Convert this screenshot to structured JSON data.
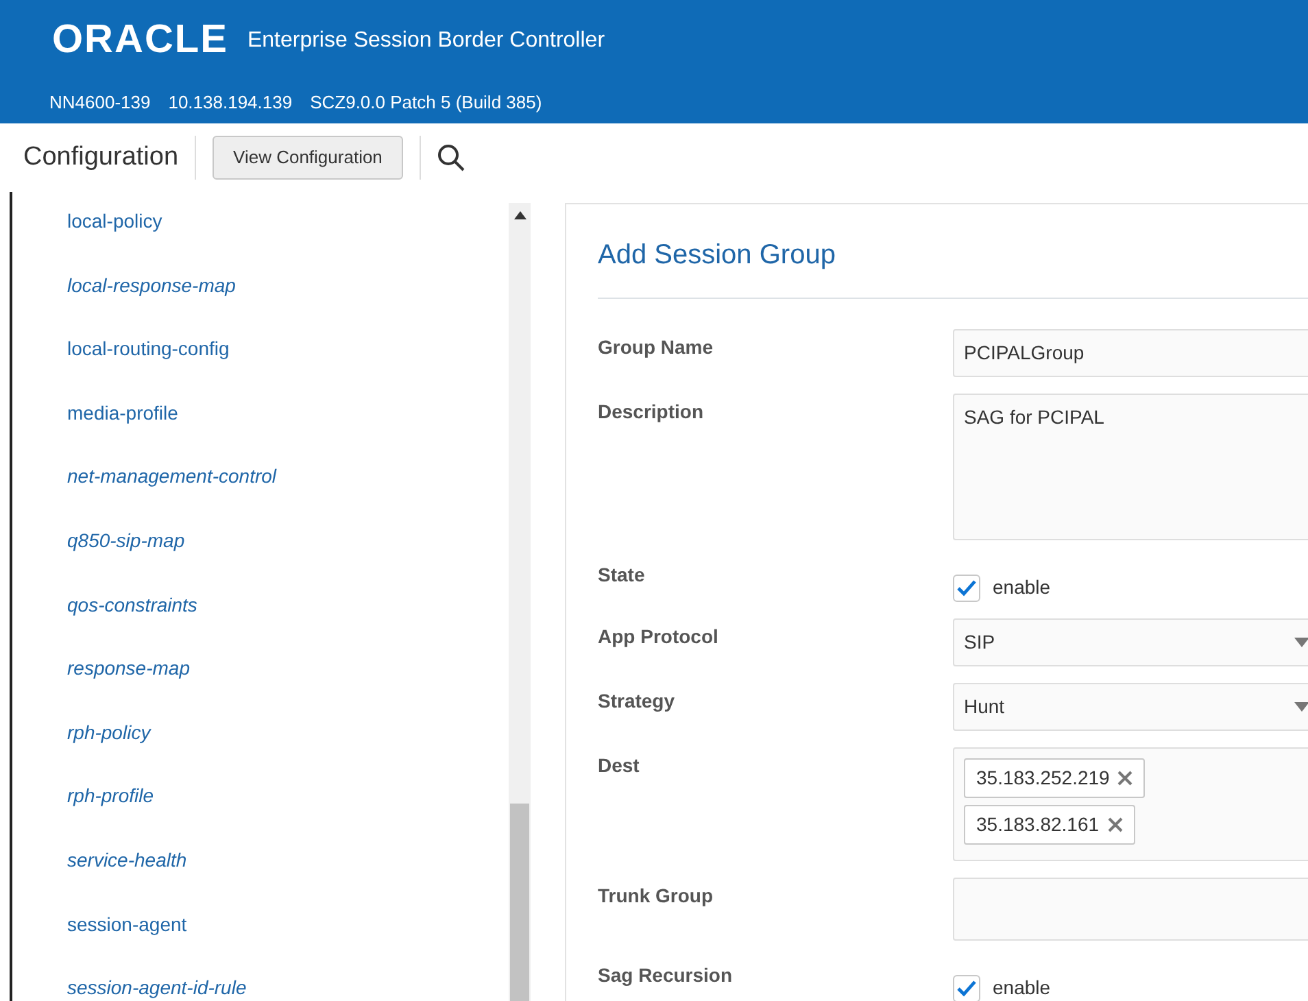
{
  "header": {
    "logo": "ORACLE",
    "product": "Enterprise Session Border Controller",
    "info": [
      "NN4600-139",
      "10.138.194.139",
      "SCZ9.0.0 Patch 5 (Build 385)"
    ]
  },
  "toolbar": {
    "title": "Configuration",
    "button": "View Configuration"
  },
  "sidebar": {
    "items": [
      {
        "label": "local-policy",
        "emphasized": false
      },
      {
        "label": "local-response-map",
        "emphasized": true
      },
      {
        "label": "local-routing-config",
        "emphasized": false
      },
      {
        "label": "media-profile",
        "emphasized": false
      },
      {
        "label": "net-management-control",
        "emphasized": true
      },
      {
        "label": "q850-sip-map",
        "emphasized": true
      },
      {
        "label": "qos-constraints",
        "emphasized": true
      },
      {
        "label": "response-map",
        "emphasized": true
      },
      {
        "label": "rph-policy",
        "emphasized": true
      },
      {
        "label": "rph-profile",
        "emphasized": true
      },
      {
        "label": "service-health",
        "emphasized": true
      },
      {
        "label": "session-agent",
        "emphasized": false
      },
      {
        "label": "session-agent-id-rule",
        "emphasized": true
      }
    ]
  },
  "form": {
    "title": "Add Session Group",
    "fields": [
      {
        "kind": "text",
        "label": "Group Name",
        "value": "PCIPALGroup"
      },
      {
        "kind": "textarea",
        "label": "Description",
        "value": "SAG for PCIPAL"
      },
      {
        "kind": "checkbox",
        "label": "State",
        "option": "enable",
        "checked": true
      },
      {
        "kind": "select",
        "label": "App Protocol",
        "value": "SIP"
      },
      {
        "kind": "select",
        "label": "Strategy",
        "value": "Hunt"
      },
      {
        "kind": "tags",
        "label": "Dest",
        "tags": [
          "35.183.252.219",
          "35.183.82.161"
        ]
      },
      {
        "kind": "textarea",
        "label": "Trunk Group"
      },
      {
        "kind": "checkbox",
        "label": "Sag Recursion",
        "option": "enable",
        "checked": true
      }
    ]
  }
}
